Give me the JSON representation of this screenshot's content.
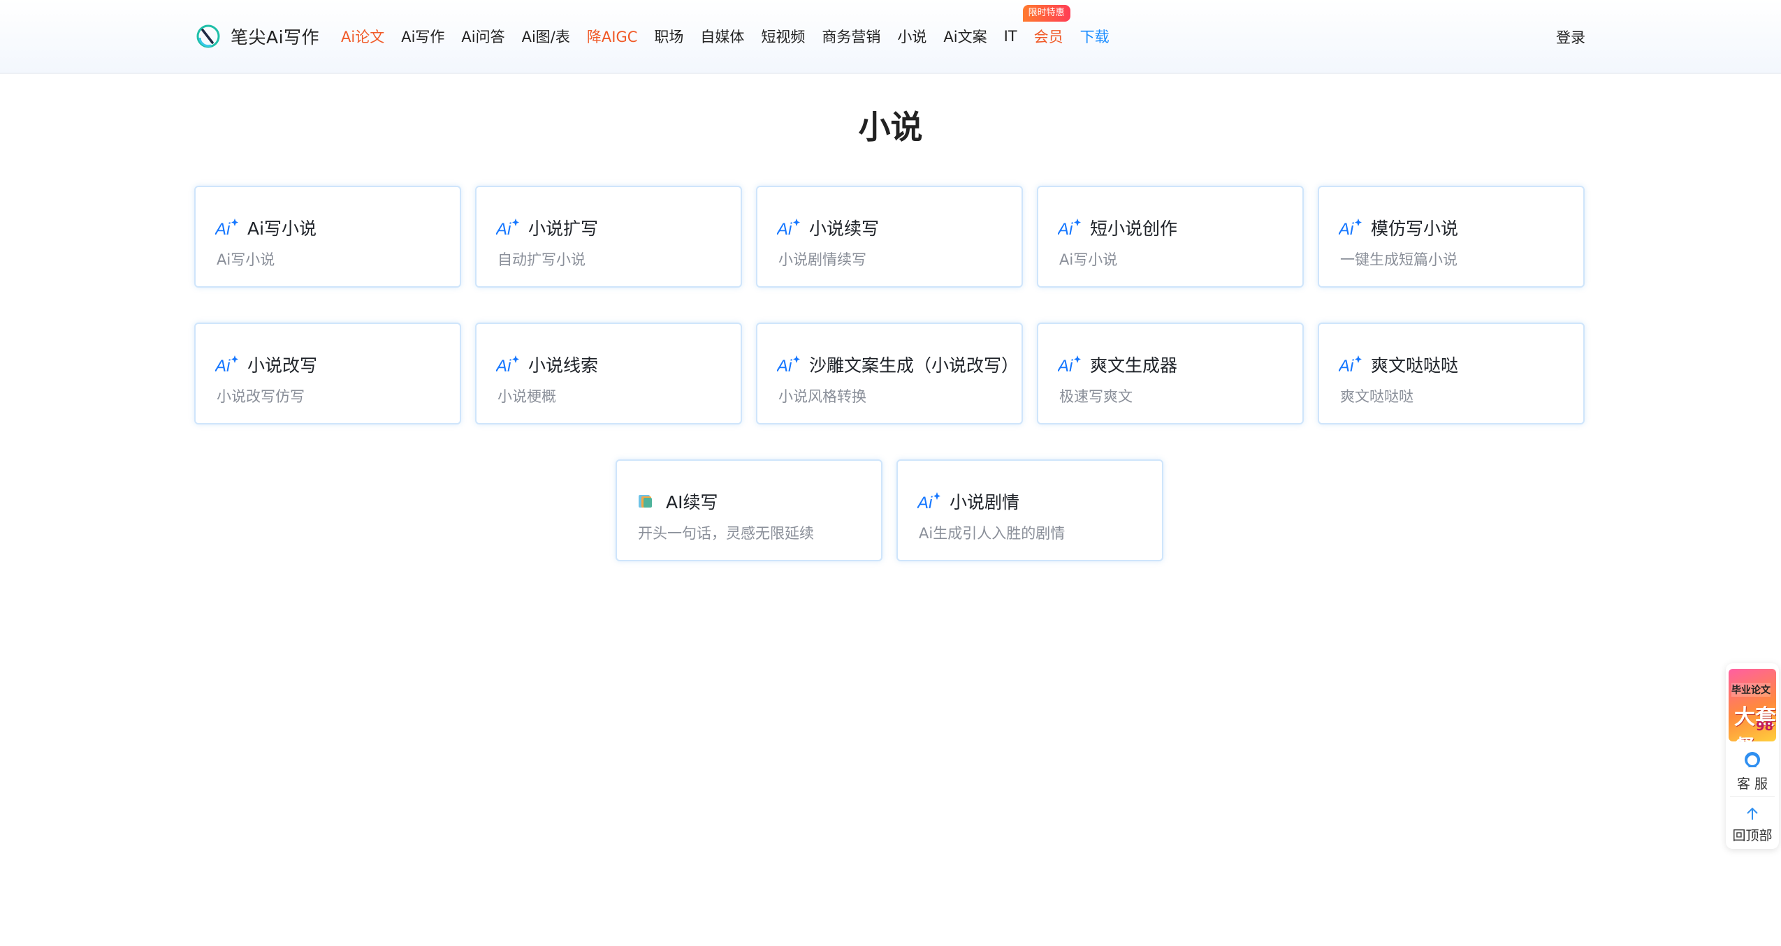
{
  "header": {
    "logo_text": "笔尖Ai写作",
    "nav": [
      {
        "label": "Ai论文",
        "style": "red"
      },
      {
        "label": "Ai写作",
        "style": ""
      },
      {
        "label": "Ai问答",
        "style": ""
      },
      {
        "label": "Ai图/表",
        "style": ""
      },
      {
        "label": "降AIGC",
        "style": "red"
      },
      {
        "label": "职场",
        "style": ""
      },
      {
        "label": "自媒体",
        "style": ""
      },
      {
        "label": "短视频",
        "style": ""
      },
      {
        "label": "商务营销",
        "style": ""
      },
      {
        "label": "小说",
        "style": ""
      },
      {
        "label": "Ai文案",
        "style": ""
      },
      {
        "label": "IT",
        "style": ""
      },
      {
        "label": "会员",
        "style": "red",
        "badge": "限时特惠"
      },
      {
        "label": "下载",
        "style": "blue"
      }
    ],
    "login_label": "登录"
  },
  "page_title": "小说",
  "cards": [
    {
      "title": "Ai写小说",
      "desc": "Ai写小说",
      "icon": "ai-sparkle-icon"
    },
    {
      "title": "小说扩写",
      "desc": "自动扩写小说",
      "icon": "ai-sparkle-icon"
    },
    {
      "title": "小说续写",
      "desc": "小说剧情续写",
      "icon": "ai-sparkle-icon"
    },
    {
      "title": "短小说创作",
      "desc": "Ai写小说",
      "icon": "ai-sparkle-icon"
    },
    {
      "title": "模仿写小说",
      "desc": "一键生成短篇小说",
      "icon": "ai-sparkle-icon"
    },
    {
      "title": "小说改写",
      "desc": "小说改写仿写",
      "icon": "ai-sparkle-icon"
    },
    {
      "title": "小说线索",
      "desc": "小说梗概",
      "icon": "ai-sparkle-icon"
    },
    {
      "title": "沙雕文案生成（小说改写）",
      "desc": "小说风格转换",
      "icon": "ai-sparkle-icon"
    },
    {
      "title": "爽文生成器",
      "desc": "极速写爽文",
      "icon": "ai-sparkle-icon"
    },
    {
      "title": "爽文哒哒哒",
      "desc": "爽文哒哒哒",
      "icon": "ai-sparkle-icon"
    },
    {
      "title": "AI续写",
      "desc": "开头一句话，灵感无限延续",
      "icon": "book-icon"
    },
    {
      "title": "小说剧情",
      "desc": "Ai生成引人入胜的剧情",
      "icon": "ai-sparkle-icon"
    }
  ],
  "side": {
    "promo_line1": "毕业论文",
    "promo_line2": "大套餐",
    "promo_price": "98",
    "service_label": "客 服",
    "top_label": "回顶部"
  },
  "colors": {
    "accent_red": "#f05a28",
    "accent_blue": "#1a8cff",
    "card_border": "#cfe5fb"
  }
}
